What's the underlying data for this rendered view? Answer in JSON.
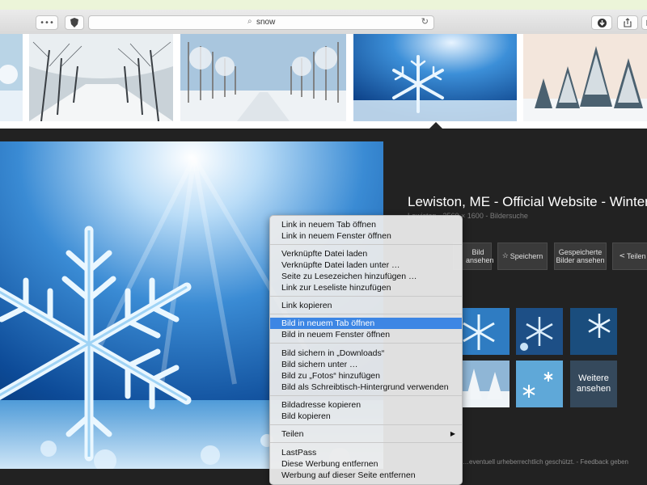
{
  "browser": {
    "address": "snow",
    "reader_label": "•••"
  },
  "details": {
    "title": "Lewiston, ME - Official Website - Winter…",
    "subtitle": "Lewiston - 2560 × 1600 - Bildersuche",
    "buttons": {
      "view": "Bild ansehen",
      "save": "Speichern",
      "saved": "Gespeicherte Bilder ansehen",
      "share": "Teilen"
    },
    "more_label": "Weitere ansehen",
    "footer": "…eventuell urheberrechtlich geschützt. - Feedback geben"
  },
  "context_menu": {
    "group1": [
      "Link in neuem Tab öffnen",
      "Link in neuem Fenster öffnen"
    ],
    "group2": [
      "Verknüpfte Datei laden",
      "Verknüpfte Datei laden unter …",
      "Seite zu Lesezeichen hinzufügen …",
      "Link zur Leseliste hinzufügen"
    ],
    "group3": [
      "Link kopieren"
    ],
    "group4": [
      "Bild in neuem Tab öffnen",
      "Bild in neuem Fenster öffnen"
    ],
    "group5": [
      "Bild sichern in „Downloads“",
      "Bild sichern unter …",
      "Bild zu „Fotos“ hinzufügen",
      "Bild als Schreibtisch-Hintergrund verwenden"
    ],
    "group6": [
      "Bildadresse kopieren",
      "Bild kopieren"
    ],
    "group7": [
      "Teilen"
    ],
    "group8": [
      "LastPass",
      "Diese Werbung entfernen",
      "Werbung auf dieser Seite entfernen"
    ],
    "highlighted": "Bild in neuem Tab öffnen"
  },
  "colors": {
    "menu_highlight": "#3d86e4",
    "panel_bg": "#222222"
  },
  "icons": [
    "reader-icon",
    "privacy-icon",
    "search-icon",
    "reload-icon",
    "download-icon",
    "share-icon",
    "tabs-icon",
    "star-icon",
    "snowflake-image"
  ]
}
